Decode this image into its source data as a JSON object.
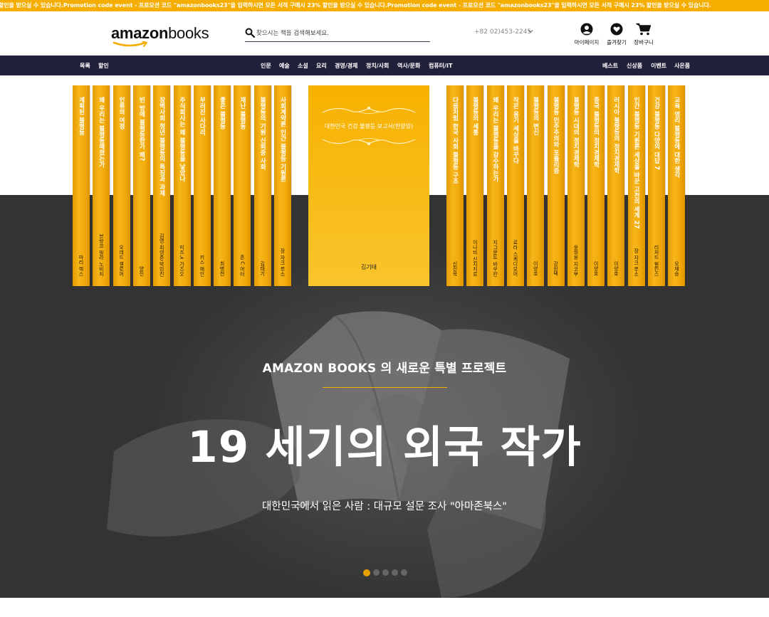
{
  "promo": {
    "text": "할인을 받으실 수 있습니다.Promotion code event - 프로모션 코드 \"amazonbooks23\"을 입력하시면 모든 서적 구매시 23% 할인을 받으실 수 있습니다.Promotion code event - 프로모션 코드 \"amazonbooks23\"을 입력하시면 모든 서적 구매시 23% 할인을 받으실 수 있습니다."
  },
  "header": {
    "logo_bold": "amazon",
    "logo_light": "books",
    "search_placeholder": "찾으시는 책을 검색해보세요.",
    "phone": "+82 02)453-2245",
    "icons": [
      {
        "label": "마이페이지",
        "icon": "user-icon"
      },
      {
        "label": "즐겨찾기",
        "icon": "heart-icon"
      },
      {
        "label": "장바구니",
        "icon": "cart-icon"
      }
    ]
  },
  "nav": {
    "left": [
      "목록",
      "할인"
    ],
    "center": [
      "인문",
      "예술",
      "소설",
      "요리",
      "경영/경제",
      "정치/사회",
      "역사/문화",
      "컴퓨터/IT"
    ],
    "right": [
      "베스트",
      "신상품",
      "이벤트",
      "사은품"
    ]
  },
  "books_left": [
    {
      "title": "계획된 불평등",
      "author": "마리 렉스"
    },
    {
      "title": "왜 우리는 불평등해졌는가",
      "author": "브랑코 밀라 노비치"
    },
    {
      "title": "인류의 여정",
      "author": "오데드 갤로어"
    },
    {
      "title": "빈 방에 불평등한가 왜?",
      "author": "양진"
    },
    {
      "title": "장벽사회 청년 불평등의 특징과 과제",
      "author": "김영·최영준·박민진"
    },
    {
      "title": "주식회사는 왜 불평등을 낳았나",
      "author": "미즈노 가즈오"
    },
    {
      "title": "부러진 사다리",
      "author": "키스 페인"
    },
    {
      "title": "좋은 불평등",
      "author": "최병천"
    },
    {
      "title": "재난 불평등",
      "author": "존 C 머터"
    },
    {
      "title": "불평등의 기원 신뢰중 사회",
      "author": "김태기"
    },
    {
      "title": "사회계약론 인간 불평등 기원론",
      "author": "장 자크 루소"
    }
  ],
  "cover": {
    "title": "대한민국 건강 불평등 보고서(한양양)",
    "author": "김기태"
  },
  "books_right": [
    {
      "title": "다음처럼 한국 사회 불평등 구조",
      "author": "신진욱"
    },
    {
      "title": "불평등의 세통",
      "author": "이나비 신지치료"
    },
    {
      "title": "왜 우리는 불평등을 감수하는가",
      "author": "지그문트 바우만"
    },
    {
      "title": "작은 용기 세상을 바꾸다",
      "author": "로라 스케디모어"
    },
    {
      "title": "불평등의 변신",
      "author": "이양호"
    },
    {
      "title": "불평등 민주주의와 포퓰리즘",
      "author": "강원택"
    },
    {
      "title": "불평등 시대의 정치경제학",
      "author": "윤희웅 지코부"
    },
    {
      "title": "중국 불평등의 정치경제학",
      "author": "이양호"
    },
    {
      "title": "러시아 불평등의 정치경제학",
      "author": "이양호"
    },
    {
      "title": "인간 불평등 기원론 세상을 바꾼 고전의 세계 27",
      "author": "장 자크 루소"
    },
    {
      "title": "건강 불평등 다양의 대답 7",
      "author": "리처드 윌킨스"
    },
    {
      "title": "교육 영리 불평등에 대한 생각",
      "author": "오재승"
    }
  ],
  "hero": {
    "subtitle": "AMAZON BOOKS 의 새로운 특별 프로젝트",
    "title": "19 세기의 외국 작가",
    "caption": "대한민국에서 읽은 사람 : 대규모 설문 조사 \"아마존북스\"",
    "slides_total": 5,
    "active_slide": 1
  },
  "colors": {
    "accent": "#f5ad00",
    "nav_bg": "#21203a",
    "hero_bg": "#333333"
  }
}
